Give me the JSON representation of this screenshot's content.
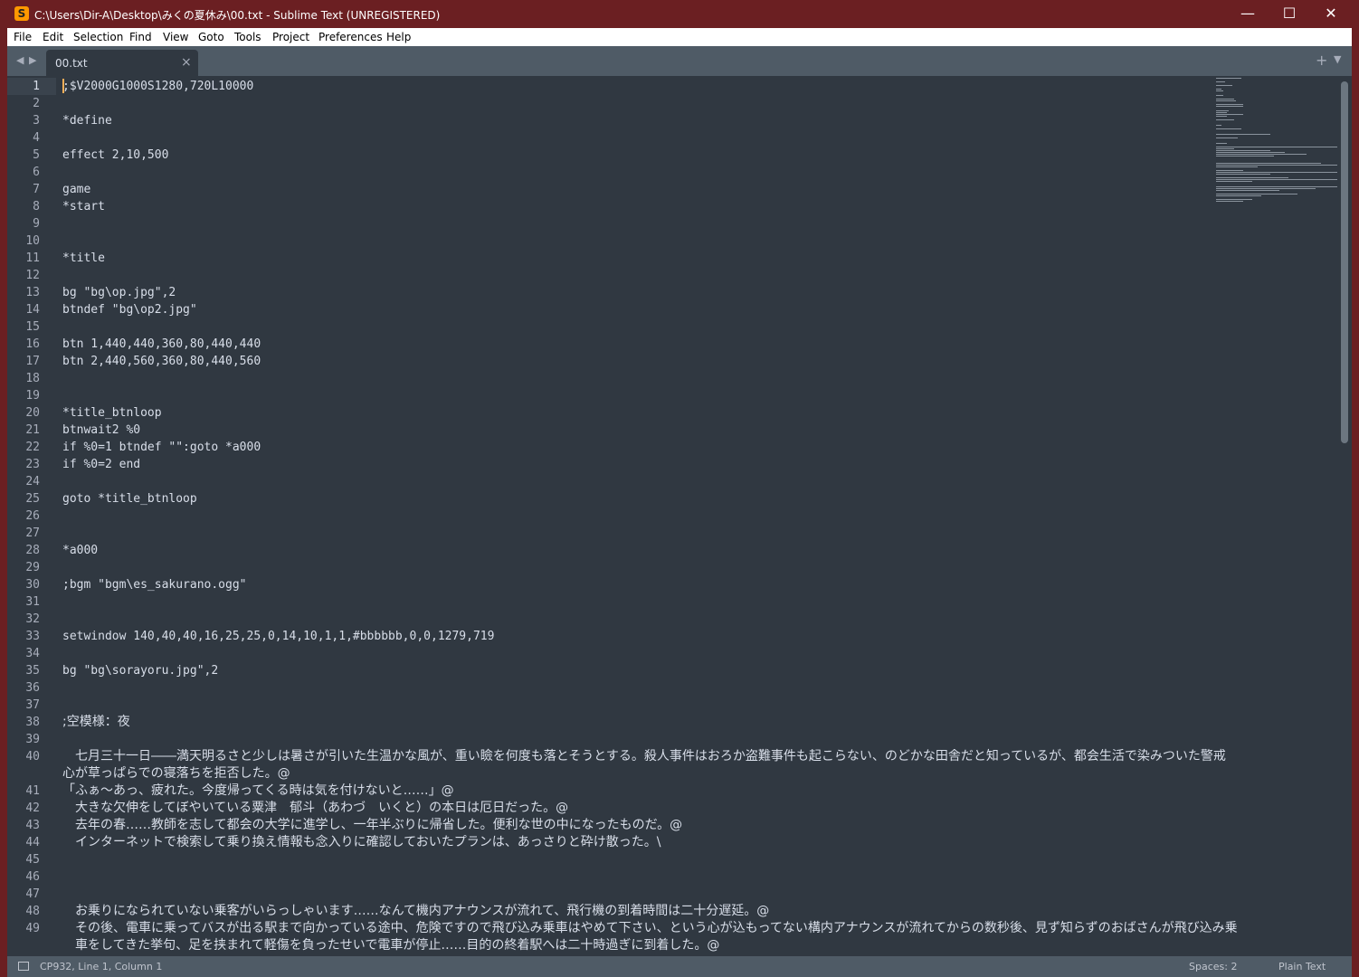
{
  "window": {
    "title": "C:\\Users\\Dir-A\\Desktop\\みくの夏休み\\00.txt - Sublime Text (UNREGISTERED)",
    "app_icon": "S",
    "minimize_glyph": "—",
    "maximize_glyph": "☐",
    "close_glyph": "✕"
  },
  "menu": [
    "File",
    "Edit",
    "Selection",
    "Find",
    "View",
    "Goto",
    "Tools",
    "Project",
    "Preferences",
    "Help"
  ],
  "tabs": {
    "nav_left": "◀",
    "nav_right": "▶",
    "active_tab": "00.txt",
    "close_glyph": "×",
    "new_tab_glyph": "+",
    "menu_glyph": "▼"
  },
  "editor": {
    "active_line": 1,
    "line_numbers": [
      "1",
      "2",
      "3",
      "4",
      "5",
      "6",
      "7",
      "8",
      "9",
      "10",
      "11",
      "12",
      "13",
      "14",
      "15",
      "16",
      "17",
      "18",
      "19",
      "20",
      "21",
      "22",
      "23",
      "24",
      "25",
      "26",
      "27",
      "28",
      "29",
      "30",
      "31",
      "32",
      "33",
      "34",
      "35",
      "36",
      "37",
      "38",
      "39",
      "40",
      "41",
      "42",
      "43",
      "44",
      "45",
      "46",
      "47",
      "48",
      "49"
    ],
    "lines": [
      ";$V2000G1000S1280,720L10000",
      "*define",
      "effect 2,10,500",
      "game",
      "*start",
      "*title",
      "bg \"bg\\op.jpg\",2",
      "btndef \"bg\\op2.jpg\"",
      "btn 1,440,440,360,80,440,440",
      "btn 2,440,560,360,80,440,560",
      "*title_btnloop",
      "btnwait2 %0",
      "if %0=1 btndef \"\":goto *a000",
      "if %0=2 end",
      "goto *title_btnloop",
      "*a000",
      ";bgm \"bgm\\es_sakurano.ogg\"",
      "setwindow 140,40,40,16,25,25,0,14,10,1,1,#bbbbbb,0,0,1279,719",
      "bg \"bg\\sorayoru.jpg\",2",
      ";空模様：夜",
      "　七月三十一日――満天明るさと少しは暑さが引いた生温かな風が、重い瞼を何度も落とそうとする。殺人事件はおろか盗難事件も起こらない、のどかな田舎だと知っているが、都会生活で染みついた警戒",
      "心が草っぱらでの寝落ちを拒否した。@",
      "「ふぁ～あっ、疲れた。今度帰ってくる時は気を付けないと……」@",
      "　大きな欠伸をしてぼやいている粟津　郁斗（あわづ　いくと）の本日は厄日だった。@",
      "　去年の春……教師を志して都会の大学に進学し、一年半ぶりに帰省した。便利な世の中になったものだ。@",
      "　インターネットで検索して乗り換え情報も念入りに確認しておいたプランは、あっさりと砕け散った。\\",
      "　お乗りになられていない乗客がいらっしゃいます……なんて機内アナウンスが流れて、飛行機の到着時間は二十分遅延。@",
      "　その後、電車に乗ってバスが出る駅まで向かっている途中、危険ですので飛び込み乗車はやめて下さい、という心が込もってない構内アナウンスが流れてからの数秒後、見ず知らずのおばさんが飛び込み乗",
      "　車をしてきた挙句、足を挟まれて軽傷を負ったせいで電車が停止……目的の終着駅へは二十時過ぎに到着した。@"
    ]
  },
  "status": {
    "encoding_position": "CP932, Line 1, Column 1",
    "indentation": "Spaces: 2",
    "syntax": "Plain Text"
  },
  "colors": {
    "title_bar": "#6b1f22",
    "editor_bg": "#303841",
    "text": "#d8dee9",
    "tab_bar": "#4f5b66",
    "cursor": "#f9ae58"
  }
}
